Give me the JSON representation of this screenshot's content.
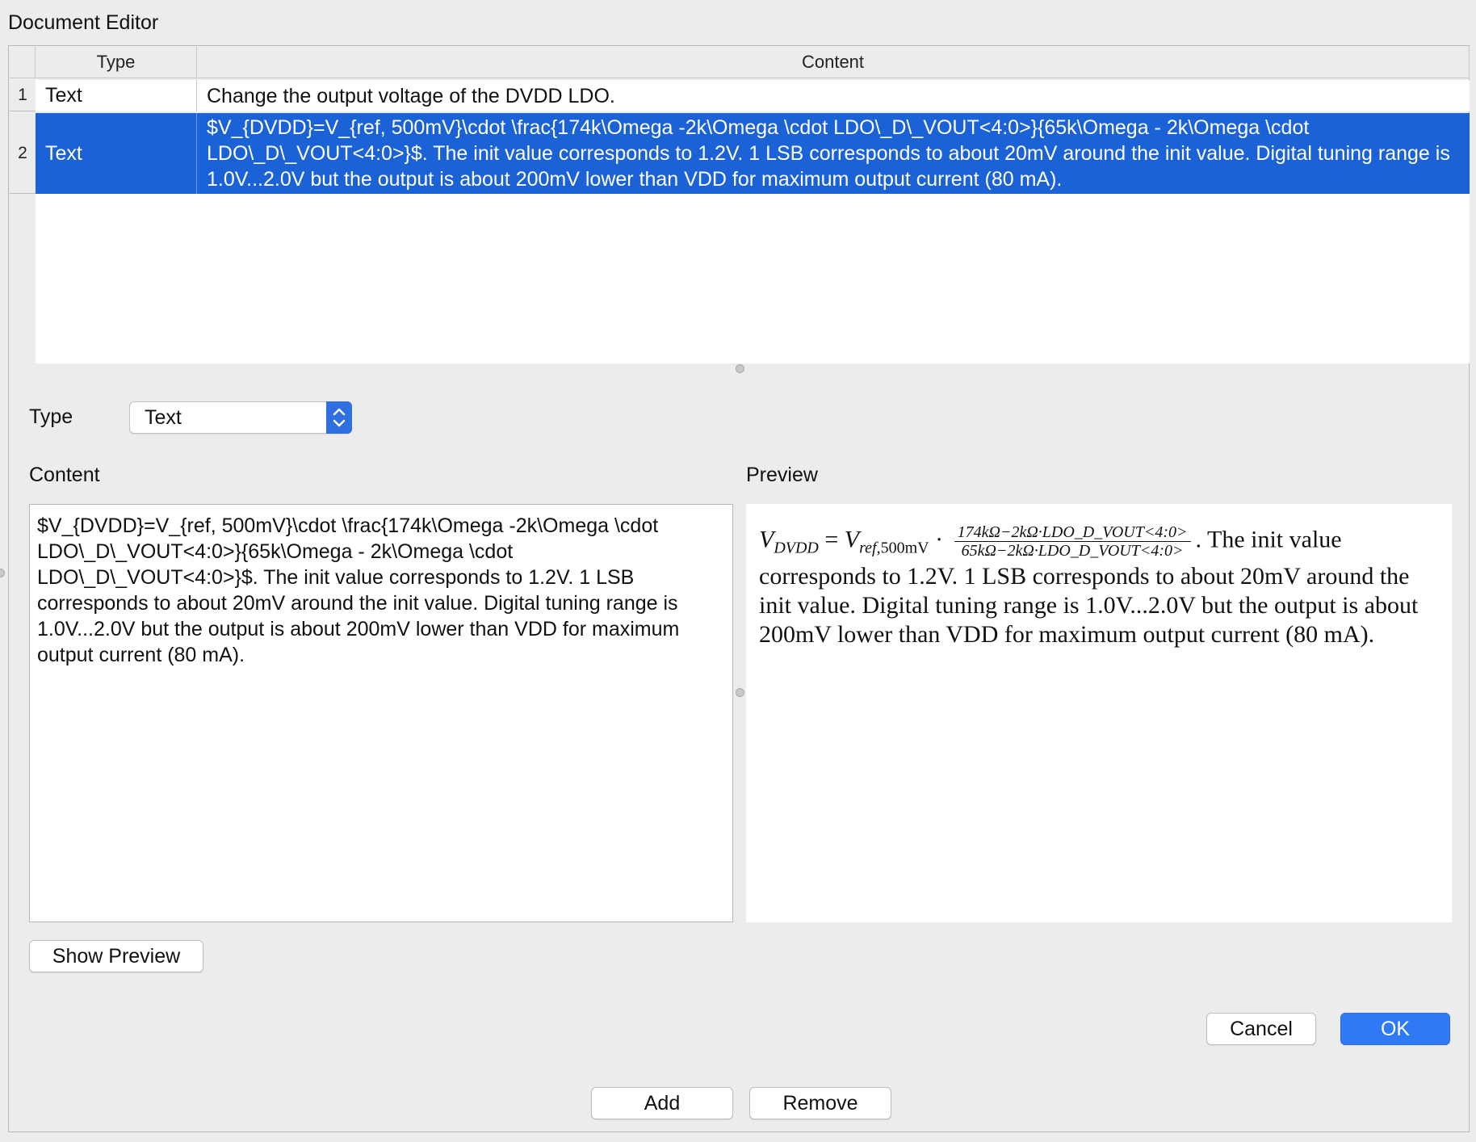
{
  "window": {
    "title": "Document Editor"
  },
  "table": {
    "headers": {
      "type": "Type",
      "content": "Content"
    },
    "rows": [
      {
        "num": "1",
        "type": "Text",
        "content": "Change the output voltage of the DVDD LDO."
      },
      {
        "num": "2",
        "type": "Text",
        "content": "$V_{DVDD}=V_{ref, 500mV}\\cdot \\frac{174k\\Omega -2k\\Omega \\cdot LDO\\_D\\_VOUT<4:0>}{65k\\Omega - 2k\\Omega \\cdot LDO\\_D\\_VOUT<4:0>}$. The init value corresponds to 1.2V. 1 LSB corresponds to about 20mV around the init value. Digital tuning range is 1.0V...2.0V but the output is about 200mV lower than VDD for maximum output current (80 mA)."
      }
    ],
    "selected_row": "2"
  },
  "editor": {
    "type_label": "Type",
    "type_value": "Text",
    "content_label": "Content",
    "preview_label": "Preview",
    "content_text": "$V_{DVDD}=V_{ref, 500mV}\\cdot \\frac{174k\\Omega -2k\\Omega \\cdot LDO\\_D\\_VOUT<4:0>}{65k\\Omega - 2k\\Omega \\cdot LDO\\_D\\_VOUT<4:0>}$. The init value corresponds to 1.2V. 1 LSB corresponds to about 20mV around the init value. Digital tuning range is 1.0V...2.0V but the output is about 200mV lower than VDD for maximum output current (80 mA).",
    "preview": {
      "lhs_main": "V",
      "lhs_sub": "DVDD",
      "equals": "=",
      "rhs_main": "V",
      "rhs_sub_ref": "ref",
      "rhs_sub_rest": ",500mV",
      "cdot": "·",
      "frac_num": "174kΩ−2kΩ·LDO_D_VOUT<4:0>",
      "frac_den": "65kΩ−2kΩ·LDO_D_VOUT<4:0>",
      "text": ". The init value corresponds to 1.2V. 1 LSB corresponds to about 20mV around the init value. Digital tuning range is 1.0V...2.0V but the output is about 200mV lower than VDD for maximum output current (80 mA)."
    }
  },
  "buttons": {
    "show_preview": "Show Preview",
    "cancel": "Cancel",
    "ok": "OK",
    "add": "Add",
    "remove": "Remove"
  },
  "colors": {
    "selection": "#1a62d6",
    "accent": "#2f7af4",
    "window_bg": "#ececec"
  }
}
